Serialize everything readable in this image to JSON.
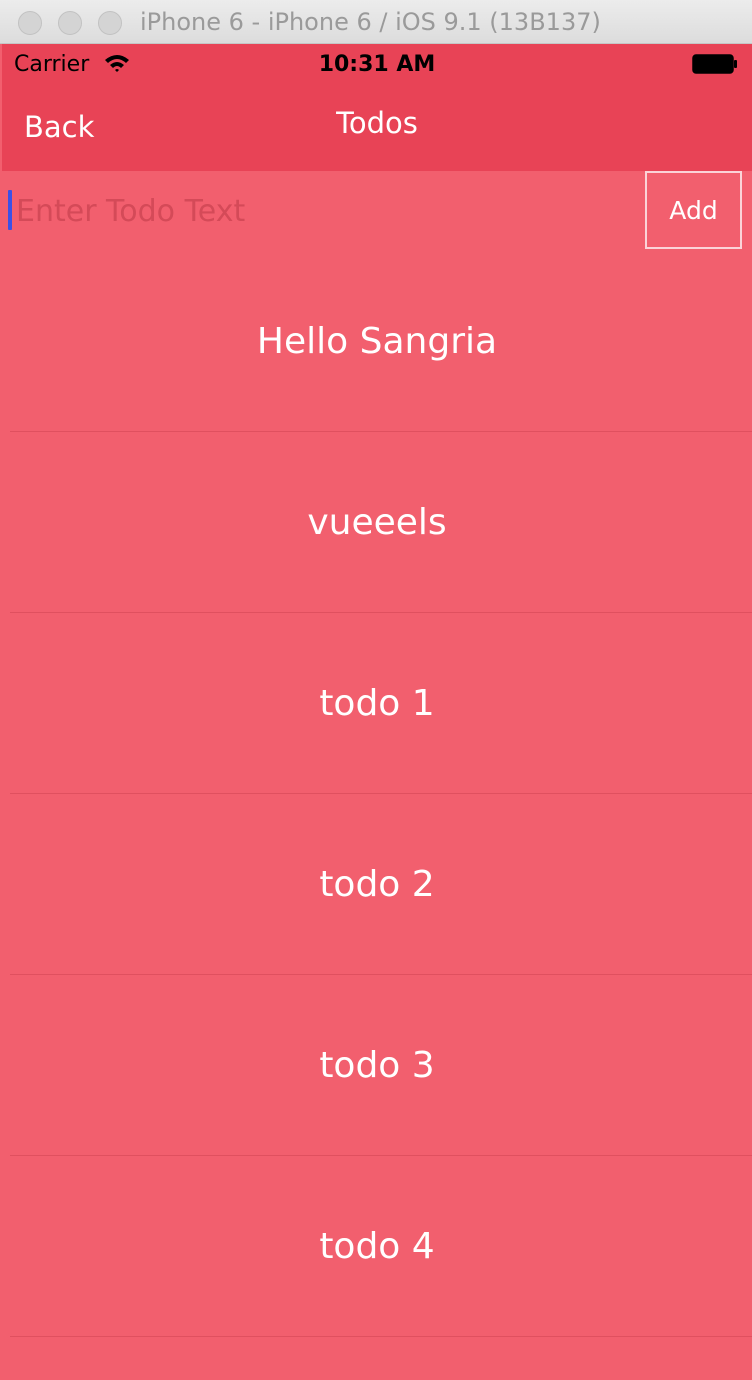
{
  "window": {
    "title": "iPhone 6 - iPhone 6 / iOS 9.1 (13B137)"
  },
  "status_bar": {
    "carrier": "Carrier",
    "time": "10:31 AM",
    "icons": [
      "wifi-icon",
      "battery-icon"
    ]
  },
  "nav": {
    "back_label": "Back",
    "title": "Todos"
  },
  "input": {
    "placeholder": "Enter Todo Text",
    "value": "",
    "add_label": "Add"
  },
  "todos": [
    "Hello Sangria",
    "vueeels",
    "todo 1",
    "todo 2",
    "todo 3",
    "todo 4"
  ],
  "colors": {
    "navbar": "#e84356",
    "background": "#f25f6e",
    "caret": "#3b50e6"
  }
}
